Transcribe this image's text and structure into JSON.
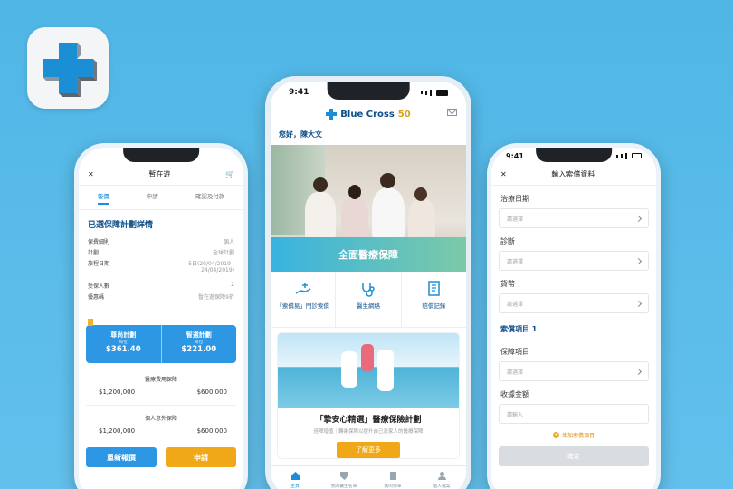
{
  "left": {
    "status_time": "",
    "header_title": "暫在遊",
    "tabs": [
      "報價",
      "申請",
      "確認及付款"
    ],
    "section_title": "已選保障計劃詳情",
    "details": [
      {
        "label": "保費細則",
        "value": "個人"
      },
      {
        "label": "計劃",
        "value": "全球計劃"
      },
      {
        "label": "旅程日期",
        "value": "5日(20/04/2019 - 24/04/2019)"
      },
      {
        "label": "受保人數",
        "value": "2"
      },
      {
        "label": "優惠碼",
        "value": "暫在遊保障9折"
      }
    ],
    "plans": [
      {
        "name": "尊尚計劃",
        "sub": "每位",
        "price": "$361.40"
      },
      {
        "name": "智選計劃",
        "sub": "每位",
        "price": "$221.00"
      }
    ],
    "coverages": [
      {
        "title": "醫療費用保障",
        "a": "$1,200,000",
        "b": "$600,000"
      },
      {
        "title": "個人意外保障",
        "a": "$1,200,000",
        "b": "$600,000"
      }
    ],
    "buttons": {
      "requote": "重新報價",
      "apply": "申請"
    }
  },
  "center": {
    "status_time": "9:41",
    "brand": "Blue Cross",
    "anniv": "50",
    "greeting": "您好，陳大文",
    "hero_caption": "全面醫療保障",
    "quick_actions": [
      {
        "label": "「索償易」門診索償",
        "icon": "hand-plus-icon"
      },
      {
        "label": "醫生網絡",
        "icon": "stethoscope-icon"
      },
      {
        "label": "賠償記錄",
        "icon": "document-icon"
      }
    ],
    "promo_title": "「摯安心精選」醫療保險計劃",
    "promo_sub": "倍障增值｜轉乘保障以提升自己及家人的醫療保障",
    "promo_button": "了解更多",
    "tabs": [
      {
        "label": "主頁",
        "icon": "home-icon"
      },
      {
        "label": "我的醫生名單",
        "icon": "heart-shield-icon"
      },
      {
        "label": "我的保單",
        "icon": "policy-icon"
      },
      {
        "label": "個人檔案",
        "icon": "user-icon"
      }
    ]
  },
  "right": {
    "status_time": "9:41",
    "header_title": "輸入索償資料",
    "fields": [
      {
        "label": "治療日期",
        "placeholder": "請選擇"
      },
      {
        "label": "診斷",
        "placeholder": "請選擇"
      },
      {
        "label": "貨幣",
        "placeholder": "請選擇"
      }
    ],
    "section": "索償項目 1",
    "items": [
      {
        "label": "保障項目",
        "placeholder": "請選擇"
      },
      {
        "label": "收據金額",
        "placeholder": "請輸入"
      }
    ],
    "add_item": "增加索償項目",
    "confirm": "確定"
  }
}
